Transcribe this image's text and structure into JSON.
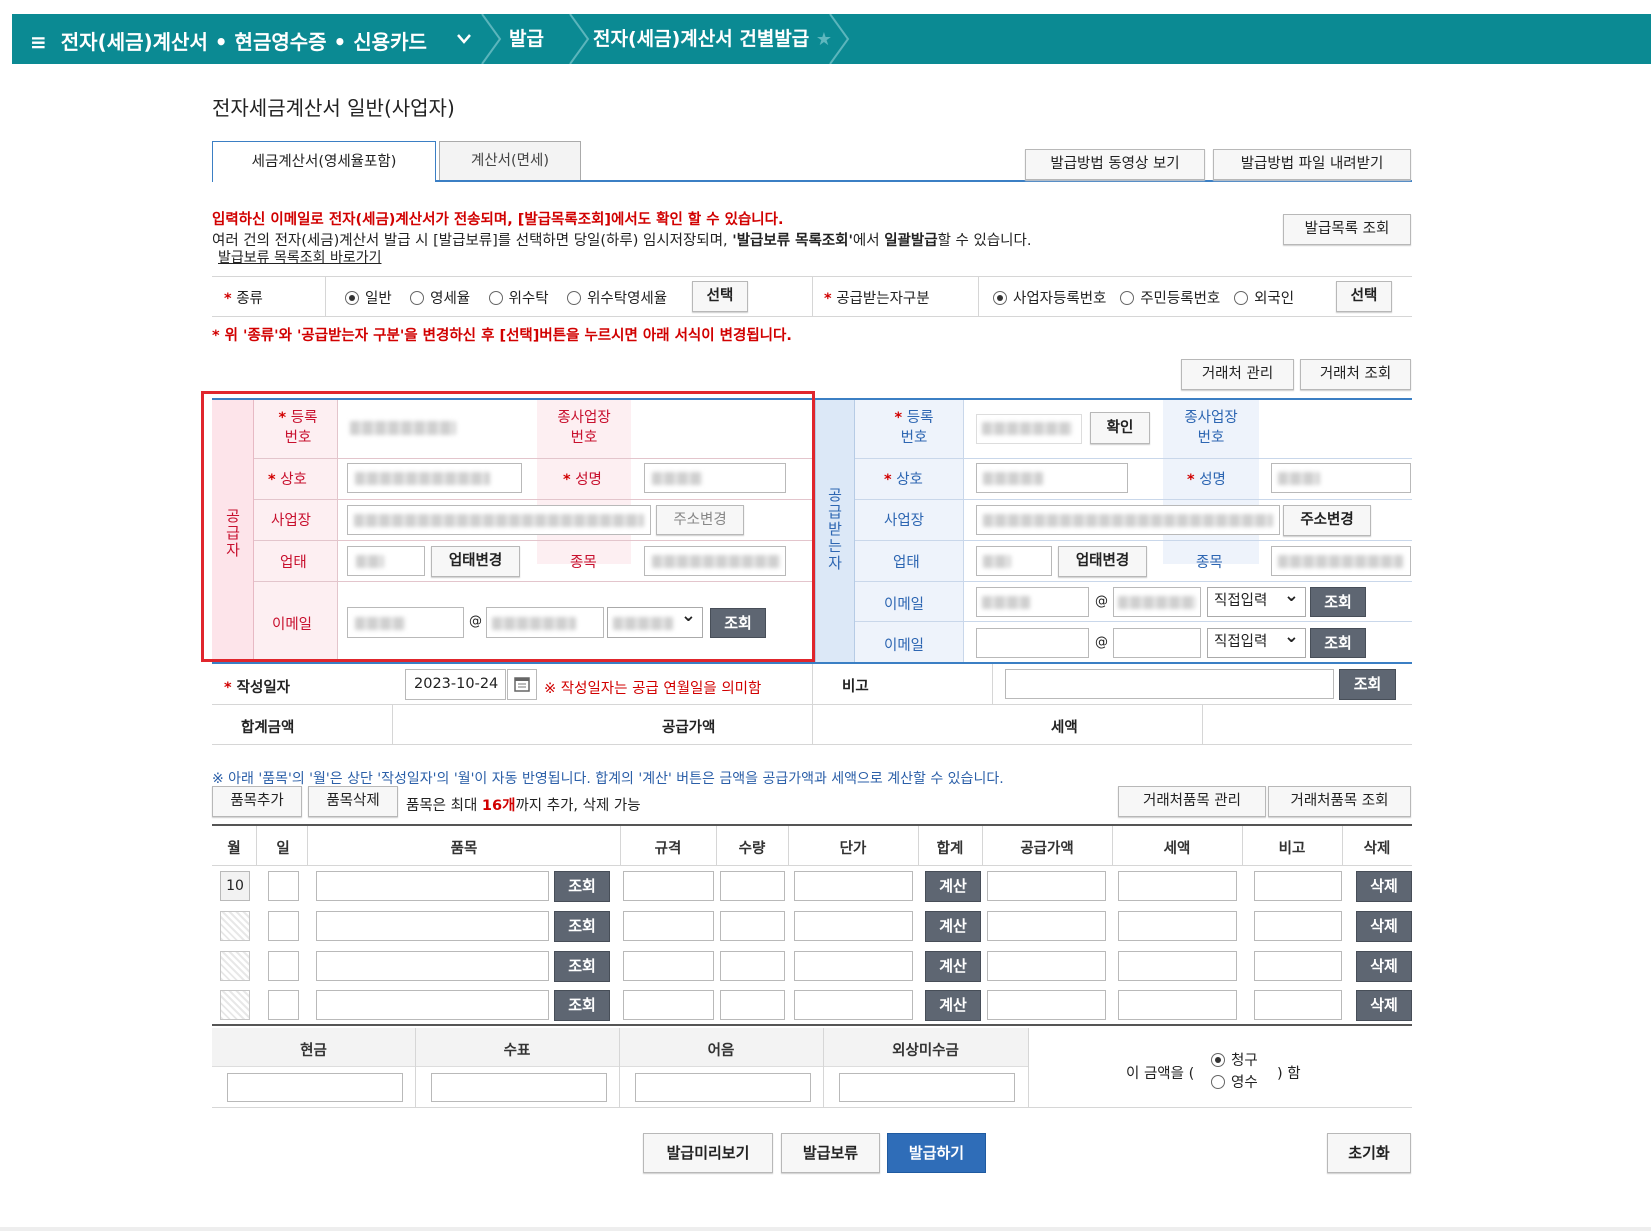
{
  "topbar": {
    "menu_icon": "≡",
    "menu_label": "전자(세금)계산서 • 현금영수증 • 신용카드",
    "crumb1": "발급",
    "crumb2": "전자(세금)계산서 건별발급",
    "star_icon": "★"
  },
  "page_title": "전자세금계산서 일반(사업자)",
  "tabs": [
    "세금계산서(영세율포함)",
    "계산서(면세)"
  ],
  "header_buttons": {
    "video": "발급방법 동영상 보기",
    "file": "발급방법 파일 내려받기",
    "list": "발급목록 조회"
  },
  "notice": {
    "line1": "입력하신 이메일로 전자(세금)계산서가 전송되며, [발급목록조회]에서도 확인 할 수 있습니다.",
    "line2a": "여러 건의 전자(세금)계산서 발급 시 [발급보류]를 선택하면 당일(하루) 임시저장되며, ",
    "line2b": "'발급보류 목록조회'",
    "line2c": "에서 ",
    "line2d": "일괄발급",
    "line2e": "할 수 있습니다.",
    "link": "발급보류 목록조회 바로가기"
  },
  "kind": {
    "label": "종류",
    "options": [
      "일반",
      "영세율",
      "위수탁",
      "위수탁영세율"
    ],
    "select_btn": "선택",
    "recv_label": "공급받는자구분",
    "recv_options": [
      "사업자등록번호",
      "주민등록번호",
      "외국인"
    ],
    "recv_select_btn": "선택",
    "warning": "* 위 '종류'와 '공급받는자 구분'을 변경하신 후 [선택]버튼을 누르시면 아래 서식이 변경됩니다."
  },
  "partner_buttons": {
    "manage": "거래처 관리",
    "search": "거래처 조회"
  },
  "supplier": {
    "side": [
      "공",
      "급",
      "자"
    ],
    "reg_no": [
      "등록",
      "번호"
    ],
    "sub_biz": [
      "종사업장",
      "번호"
    ],
    "name": "상호",
    "ceo": "성명",
    "address": "사업장",
    "addr_btn": "주소변경",
    "biz_type": "업태",
    "biz_type_btn": "업태변경",
    "item": "종목",
    "email": "이메일",
    "at": "@",
    "search_btn": "조회"
  },
  "receiver": {
    "side": [
      "공",
      "급",
      "받",
      "는",
      "자"
    ],
    "reg_no": [
      "등록",
      "번호"
    ],
    "confirm_btn": "확인",
    "sub_biz": [
      "종사업장",
      "번호"
    ],
    "name": "상호",
    "ceo": "성명",
    "address": "사업장",
    "addr_btn": "주소변경",
    "biz_type": "업태",
    "biz_type_btn": "업태변경",
    "item": "종목",
    "email1": "이메일",
    "email2": "이메일",
    "at": "@",
    "domain_select": "직접입력",
    "search_btn": "조회"
  },
  "date_row": {
    "label": "작성일자",
    "value": "2023-10-24",
    "note": "※ 작성일자는 공급 연월일을 의미함",
    "memo_label": "비고",
    "memo_btn": "조회"
  },
  "sum_row": {
    "total": "합계금액",
    "supply": "공급가액",
    "tax": "세액"
  },
  "items": {
    "note": "※ 아래 '품목'의 '월'은 상단 '작성일자'의 '월'이 자동 반영됩니다. 합계의 '계산' 버튼은 금액을 공급가액과 세액으로 계산할 수 있습니다.",
    "add_btn": "품목추가",
    "del_btn": "품목삭제",
    "limit_a": "품목은 최대 ",
    "limit_b": "16개",
    "limit_c": "까지 추가, 삭제 가능",
    "manage_btn": "거래처품목 관리",
    "search_btn": "거래처품목 조회",
    "headers": [
      "월",
      "일",
      "품목",
      "규격",
      "수량",
      "단가",
      "합계",
      "공급가액",
      "세액",
      "비고",
      "삭제"
    ],
    "row_month": "10",
    "row_search": "조회",
    "row_calc": "계산",
    "row_delete": "삭제"
  },
  "payment": {
    "headers": [
      "현금",
      "수표",
      "어음",
      "외상미수금"
    ],
    "claim_prefix": "이 금액을 (",
    "claim_options": [
      "청구",
      "영수"
    ],
    "claim_suffix": ") 함"
  },
  "bottom_buttons": {
    "preview": "발급미리보기",
    "hold": "발급보류",
    "issue": "발급하기",
    "reset": "초기화"
  }
}
